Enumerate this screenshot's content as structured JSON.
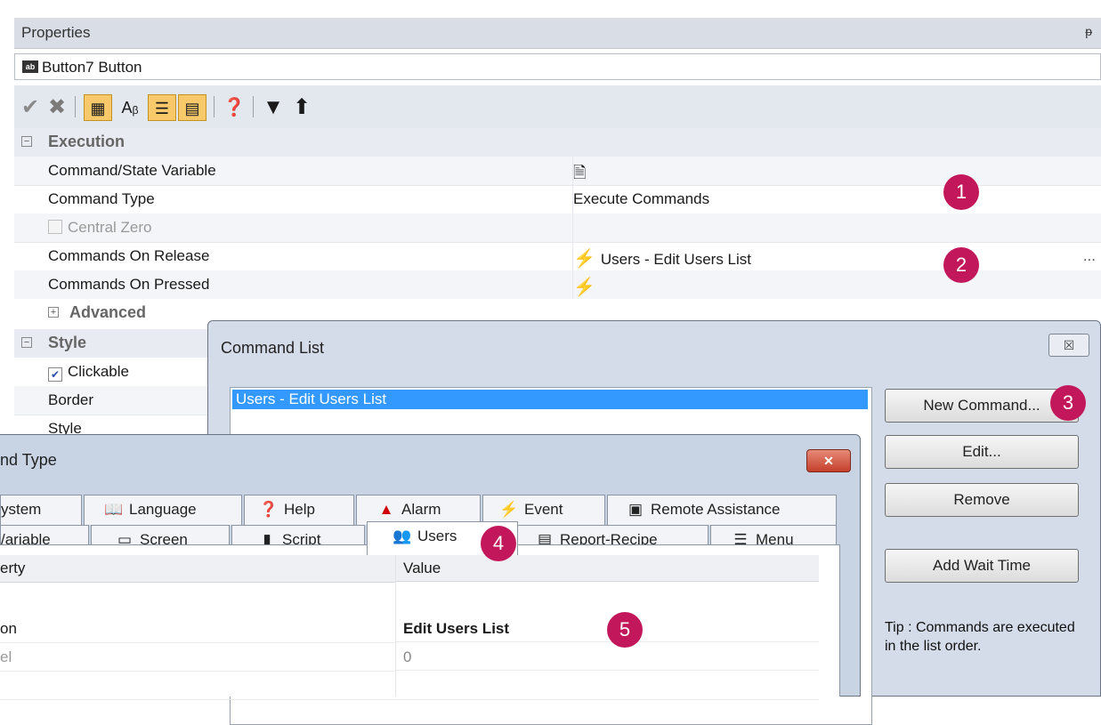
{
  "properties": {
    "title": "Properties",
    "pin": "ᵽ",
    "object_label": "Button7 Button",
    "object_icon_text": "ab",
    "toolbar_icons": [
      "check-icon",
      "delete-icon",
      "categorized-icon",
      "alphabetical-icon",
      "properties-icon",
      "events-icon",
      "help-icon",
      "filter-icon",
      "up-icon"
    ],
    "categories": {
      "execution": "Execution",
      "advanced": "Advanced",
      "style": "Style"
    },
    "rows": [
      {
        "name": "Command/State Variable",
        "value": ""
      },
      {
        "name": "Command Type",
        "value": "Execute Commands"
      },
      {
        "name": "Central Zero",
        "value": ""
      },
      {
        "name": "Commands On Release",
        "value": "Users - Edit Users List",
        "ellipsis": "..."
      },
      {
        "name": "Commands On Pressed",
        "value": ""
      }
    ],
    "style_rows": [
      {
        "name": "Clickable"
      },
      {
        "name": "Border"
      },
      {
        "name": "Style"
      }
    ]
  },
  "command_list": {
    "title": "Command List",
    "close": "☒",
    "items": [
      "Users - Edit Users List"
    ],
    "buttons": {
      "new": "New Command...",
      "edit": "Edit...",
      "remove": "Remove",
      "add_wait": "Add Wait Time"
    },
    "tip": "Tip : Commands are executed in the list order."
  },
  "command_type": {
    "title": "nd Type",
    "close": "✕",
    "tabs_row1": [
      "ystem",
      "Language",
      "Help",
      "Alarm",
      "Event",
      "Remote Assistance"
    ],
    "tabs_row2": [
      "/ariable",
      "Screen",
      "Script",
      "Users",
      "Report-Recipe",
      "Menu"
    ],
    "table": {
      "headers": [
        "erty",
        "Value"
      ],
      "rows": [
        {
          "property": "on",
          "value": "Edit Users List"
        },
        {
          "property": "el",
          "value": "0"
        }
      ]
    }
  },
  "badges": [
    "1",
    "2",
    "3",
    "4",
    "5"
  ],
  "colors": {
    "badge": "#c2185b",
    "selection": "#3399ff",
    "active_toolbar": "#f7c96a"
  }
}
